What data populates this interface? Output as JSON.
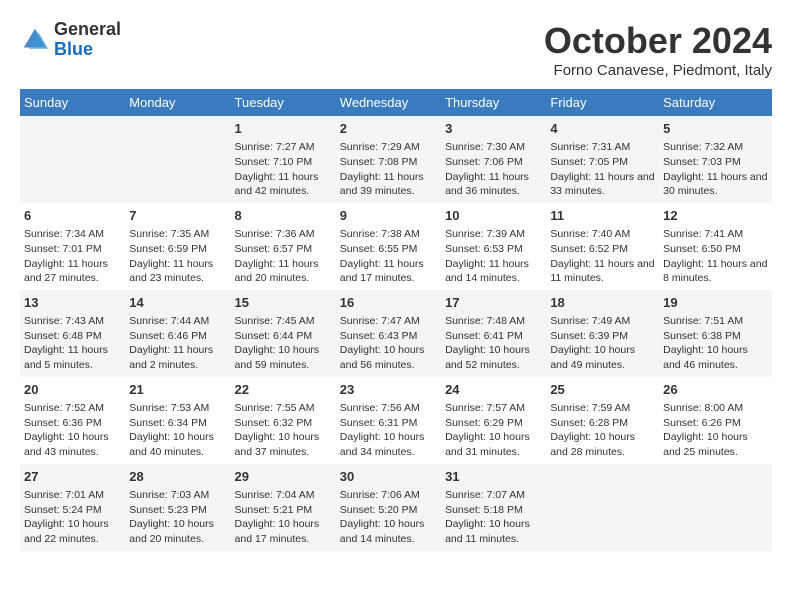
{
  "header": {
    "logo_general": "General",
    "logo_blue": "Blue",
    "month_year": "October 2024",
    "location": "Forno Canavese, Piedmont, Italy"
  },
  "days_of_week": [
    "Sunday",
    "Monday",
    "Tuesday",
    "Wednesday",
    "Thursday",
    "Friday",
    "Saturday"
  ],
  "weeks": [
    [
      {
        "day": "",
        "content": ""
      },
      {
        "day": "",
        "content": ""
      },
      {
        "day": "1",
        "content": "Sunrise: 7:27 AM\nSunset: 7:10 PM\nDaylight: 11 hours and 42 minutes."
      },
      {
        "day": "2",
        "content": "Sunrise: 7:29 AM\nSunset: 7:08 PM\nDaylight: 11 hours and 39 minutes."
      },
      {
        "day": "3",
        "content": "Sunrise: 7:30 AM\nSunset: 7:06 PM\nDaylight: 11 hours and 36 minutes."
      },
      {
        "day": "4",
        "content": "Sunrise: 7:31 AM\nSunset: 7:05 PM\nDaylight: 11 hours and 33 minutes."
      },
      {
        "day": "5",
        "content": "Sunrise: 7:32 AM\nSunset: 7:03 PM\nDaylight: 11 hours and 30 minutes."
      }
    ],
    [
      {
        "day": "6",
        "content": "Sunrise: 7:34 AM\nSunset: 7:01 PM\nDaylight: 11 hours and 27 minutes."
      },
      {
        "day": "7",
        "content": "Sunrise: 7:35 AM\nSunset: 6:59 PM\nDaylight: 11 hours and 23 minutes."
      },
      {
        "day": "8",
        "content": "Sunrise: 7:36 AM\nSunset: 6:57 PM\nDaylight: 11 hours and 20 minutes."
      },
      {
        "day": "9",
        "content": "Sunrise: 7:38 AM\nSunset: 6:55 PM\nDaylight: 11 hours and 17 minutes."
      },
      {
        "day": "10",
        "content": "Sunrise: 7:39 AM\nSunset: 6:53 PM\nDaylight: 11 hours and 14 minutes."
      },
      {
        "day": "11",
        "content": "Sunrise: 7:40 AM\nSunset: 6:52 PM\nDaylight: 11 hours and 11 minutes."
      },
      {
        "day": "12",
        "content": "Sunrise: 7:41 AM\nSunset: 6:50 PM\nDaylight: 11 hours and 8 minutes."
      }
    ],
    [
      {
        "day": "13",
        "content": "Sunrise: 7:43 AM\nSunset: 6:48 PM\nDaylight: 11 hours and 5 minutes."
      },
      {
        "day": "14",
        "content": "Sunrise: 7:44 AM\nSunset: 6:46 PM\nDaylight: 11 hours and 2 minutes."
      },
      {
        "day": "15",
        "content": "Sunrise: 7:45 AM\nSunset: 6:44 PM\nDaylight: 10 hours and 59 minutes."
      },
      {
        "day": "16",
        "content": "Sunrise: 7:47 AM\nSunset: 6:43 PM\nDaylight: 10 hours and 56 minutes."
      },
      {
        "day": "17",
        "content": "Sunrise: 7:48 AM\nSunset: 6:41 PM\nDaylight: 10 hours and 52 minutes."
      },
      {
        "day": "18",
        "content": "Sunrise: 7:49 AM\nSunset: 6:39 PM\nDaylight: 10 hours and 49 minutes."
      },
      {
        "day": "19",
        "content": "Sunrise: 7:51 AM\nSunset: 6:38 PM\nDaylight: 10 hours and 46 minutes."
      }
    ],
    [
      {
        "day": "20",
        "content": "Sunrise: 7:52 AM\nSunset: 6:36 PM\nDaylight: 10 hours and 43 minutes."
      },
      {
        "day": "21",
        "content": "Sunrise: 7:53 AM\nSunset: 6:34 PM\nDaylight: 10 hours and 40 minutes."
      },
      {
        "day": "22",
        "content": "Sunrise: 7:55 AM\nSunset: 6:32 PM\nDaylight: 10 hours and 37 minutes."
      },
      {
        "day": "23",
        "content": "Sunrise: 7:56 AM\nSunset: 6:31 PM\nDaylight: 10 hours and 34 minutes."
      },
      {
        "day": "24",
        "content": "Sunrise: 7:57 AM\nSunset: 6:29 PM\nDaylight: 10 hours and 31 minutes."
      },
      {
        "day": "25",
        "content": "Sunrise: 7:59 AM\nSunset: 6:28 PM\nDaylight: 10 hours and 28 minutes."
      },
      {
        "day": "26",
        "content": "Sunrise: 8:00 AM\nSunset: 6:26 PM\nDaylight: 10 hours and 25 minutes."
      }
    ],
    [
      {
        "day": "27",
        "content": "Sunrise: 7:01 AM\nSunset: 5:24 PM\nDaylight: 10 hours and 22 minutes."
      },
      {
        "day": "28",
        "content": "Sunrise: 7:03 AM\nSunset: 5:23 PM\nDaylight: 10 hours and 20 minutes."
      },
      {
        "day": "29",
        "content": "Sunrise: 7:04 AM\nSunset: 5:21 PM\nDaylight: 10 hours and 17 minutes."
      },
      {
        "day": "30",
        "content": "Sunrise: 7:06 AM\nSunset: 5:20 PM\nDaylight: 10 hours and 14 minutes."
      },
      {
        "day": "31",
        "content": "Sunrise: 7:07 AM\nSunset: 5:18 PM\nDaylight: 10 hours and 11 minutes."
      },
      {
        "day": "",
        "content": ""
      },
      {
        "day": "",
        "content": ""
      }
    ]
  ]
}
